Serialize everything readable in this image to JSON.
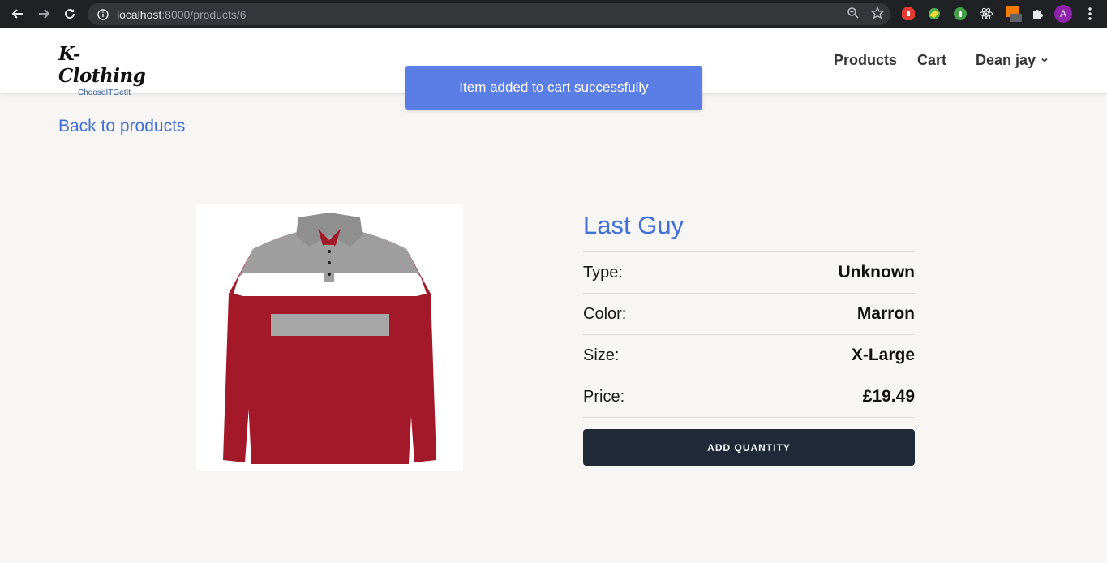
{
  "browser": {
    "url_host": "localhost",
    "url_rest": ":8000/products/6",
    "avatar_letter": "A",
    "icons": [
      "back-arrow-icon",
      "forward-arrow-icon",
      "reload-icon",
      "info-icon",
      "zoom-icon",
      "star-icon",
      "extension-icons",
      "puzzle-icon",
      "kebab-menu-icon"
    ]
  },
  "header": {
    "logo_main": "K-Clothing",
    "logo_sub": "ChooseITGetIt",
    "nav": {
      "products": "Products",
      "cart": "Cart",
      "user": "Dean jay"
    }
  },
  "toast": {
    "message": "Item added to cart successfully"
  },
  "page": {
    "back_link": "Back to products"
  },
  "product": {
    "title": "Last Guy",
    "rows": [
      {
        "label": "Type:",
        "value": "Unknown"
      },
      {
        "label": "Color:",
        "value": "Marron"
      },
      {
        "label": "Size:",
        "value": "X-Large"
      },
      {
        "label": "Price:",
        "value": "£19.49"
      }
    ],
    "button_label": "ADD QUANTITY"
  },
  "colors": {
    "accent": "#3f6fd9",
    "toast_bg": "#5a7ee6",
    "button_bg": "#1f2937"
  }
}
